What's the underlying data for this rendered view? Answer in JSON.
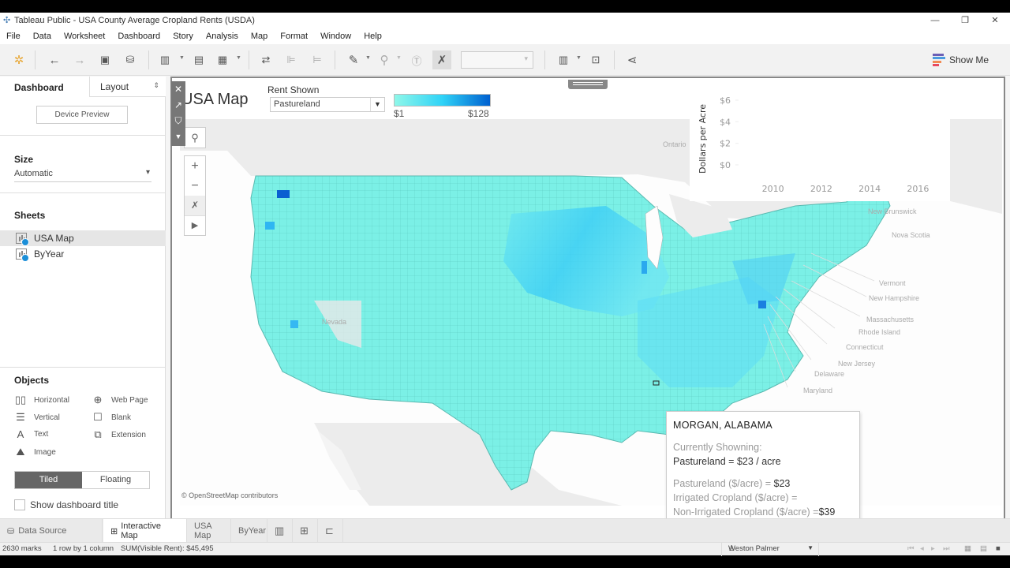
{
  "window": {
    "title": "Tableau Public - USA County Average Cropland Rents (USDA)",
    "controls": [
      "minimize",
      "restore",
      "close"
    ]
  },
  "menu": [
    "File",
    "Data",
    "Worksheet",
    "Dashboard",
    "Story",
    "Analysis",
    "Map",
    "Format",
    "Window",
    "Help"
  ],
  "toolbar": {
    "show_me_label": "Show Me",
    "show_me_colors": [
      "#6b5fb5",
      "#4a9be0",
      "#f28b54",
      "#e84a5f"
    ]
  },
  "left_panel": {
    "tab_dashboard": "Dashboard",
    "tab_layout": "Layout",
    "device_preview": "Device Preview",
    "size_heading": "Size",
    "size_value": "Automatic",
    "sheets_heading": "Sheets",
    "sheets": [
      {
        "label": "USA Map",
        "selected": true
      },
      {
        "label": "ByYear",
        "selected": false
      }
    ],
    "objects_heading": "Objects",
    "objects": [
      {
        "label": "Horizontal",
        "icon": "horizontal-container-icon"
      },
      {
        "label": "Web Page",
        "icon": "globe-icon"
      },
      {
        "label": "Vertical",
        "icon": "vertical-container-icon"
      },
      {
        "label": "Blank",
        "icon": "blank-icon"
      },
      {
        "label": "Text",
        "icon": "text-icon"
      },
      {
        "label": "Extension",
        "icon": "puzzle-icon"
      },
      {
        "label": "Image",
        "icon": "image-icon"
      }
    ],
    "tiled": "Tiled",
    "floating": "Floating",
    "show_title_label": "Show dashboard title",
    "show_title_checked": false
  },
  "dashboard": {
    "title": "USA Map",
    "filter_label": "Rent Shown",
    "filter_value": "Pastureland",
    "legend_min": "$1",
    "legend_max": "$128",
    "legend_colors": [
      "#8ff7e9",
      "#2fd3f7",
      "#0060d0"
    ],
    "attribution": "© OpenStreetMap contributors",
    "map_labels": [
      "Ontario",
      "New Brunswick",
      "Nova Scotia",
      "Vermont",
      "New Hampshire",
      "Massachusetts",
      "Rhode Island",
      "Connecticut",
      "New Jersey",
      "Delaware",
      "Maryland",
      "Nevada"
    ]
  },
  "chart_data": {
    "type": "line",
    "title": "",
    "ylabel": "Dollars per Acre",
    "xlabel": "",
    "y_ticks": [
      "$6",
      "$4",
      "$2",
      "$0"
    ],
    "x_ticks": [
      "2010",
      "2012",
      "2014",
      "2016"
    ],
    "ylim": [
      0,
      6
    ],
    "series": []
  },
  "tooltip": {
    "title": "MORGAN, ALABAMA",
    "showing_label": "Currently Showning:",
    "showing_value": "Pastureland = $23 / acre",
    "rows": [
      {
        "label": "Pastureland ($/acre) = ",
        "value": "$23"
      },
      {
        "label": "Irrigated Cropland ($/acre) = ",
        "value": ""
      },
      {
        "label": "Non-Irrigated Cropland ($/acre) =",
        "value": "$39"
      }
    ]
  },
  "bottom_tabs": {
    "data_source": "Data Source",
    "sheets": [
      {
        "label": "Interactive Map",
        "active": true
      },
      {
        "label": "USA Map",
        "active": false
      },
      {
        "label": "ByYear",
        "active": false
      }
    ]
  },
  "status": {
    "marks": "2630 marks",
    "dims": "1 row by 1 column",
    "sum": "SUM(Visible Rent): $45,495",
    "user": "Weston Palmer"
  }
}
